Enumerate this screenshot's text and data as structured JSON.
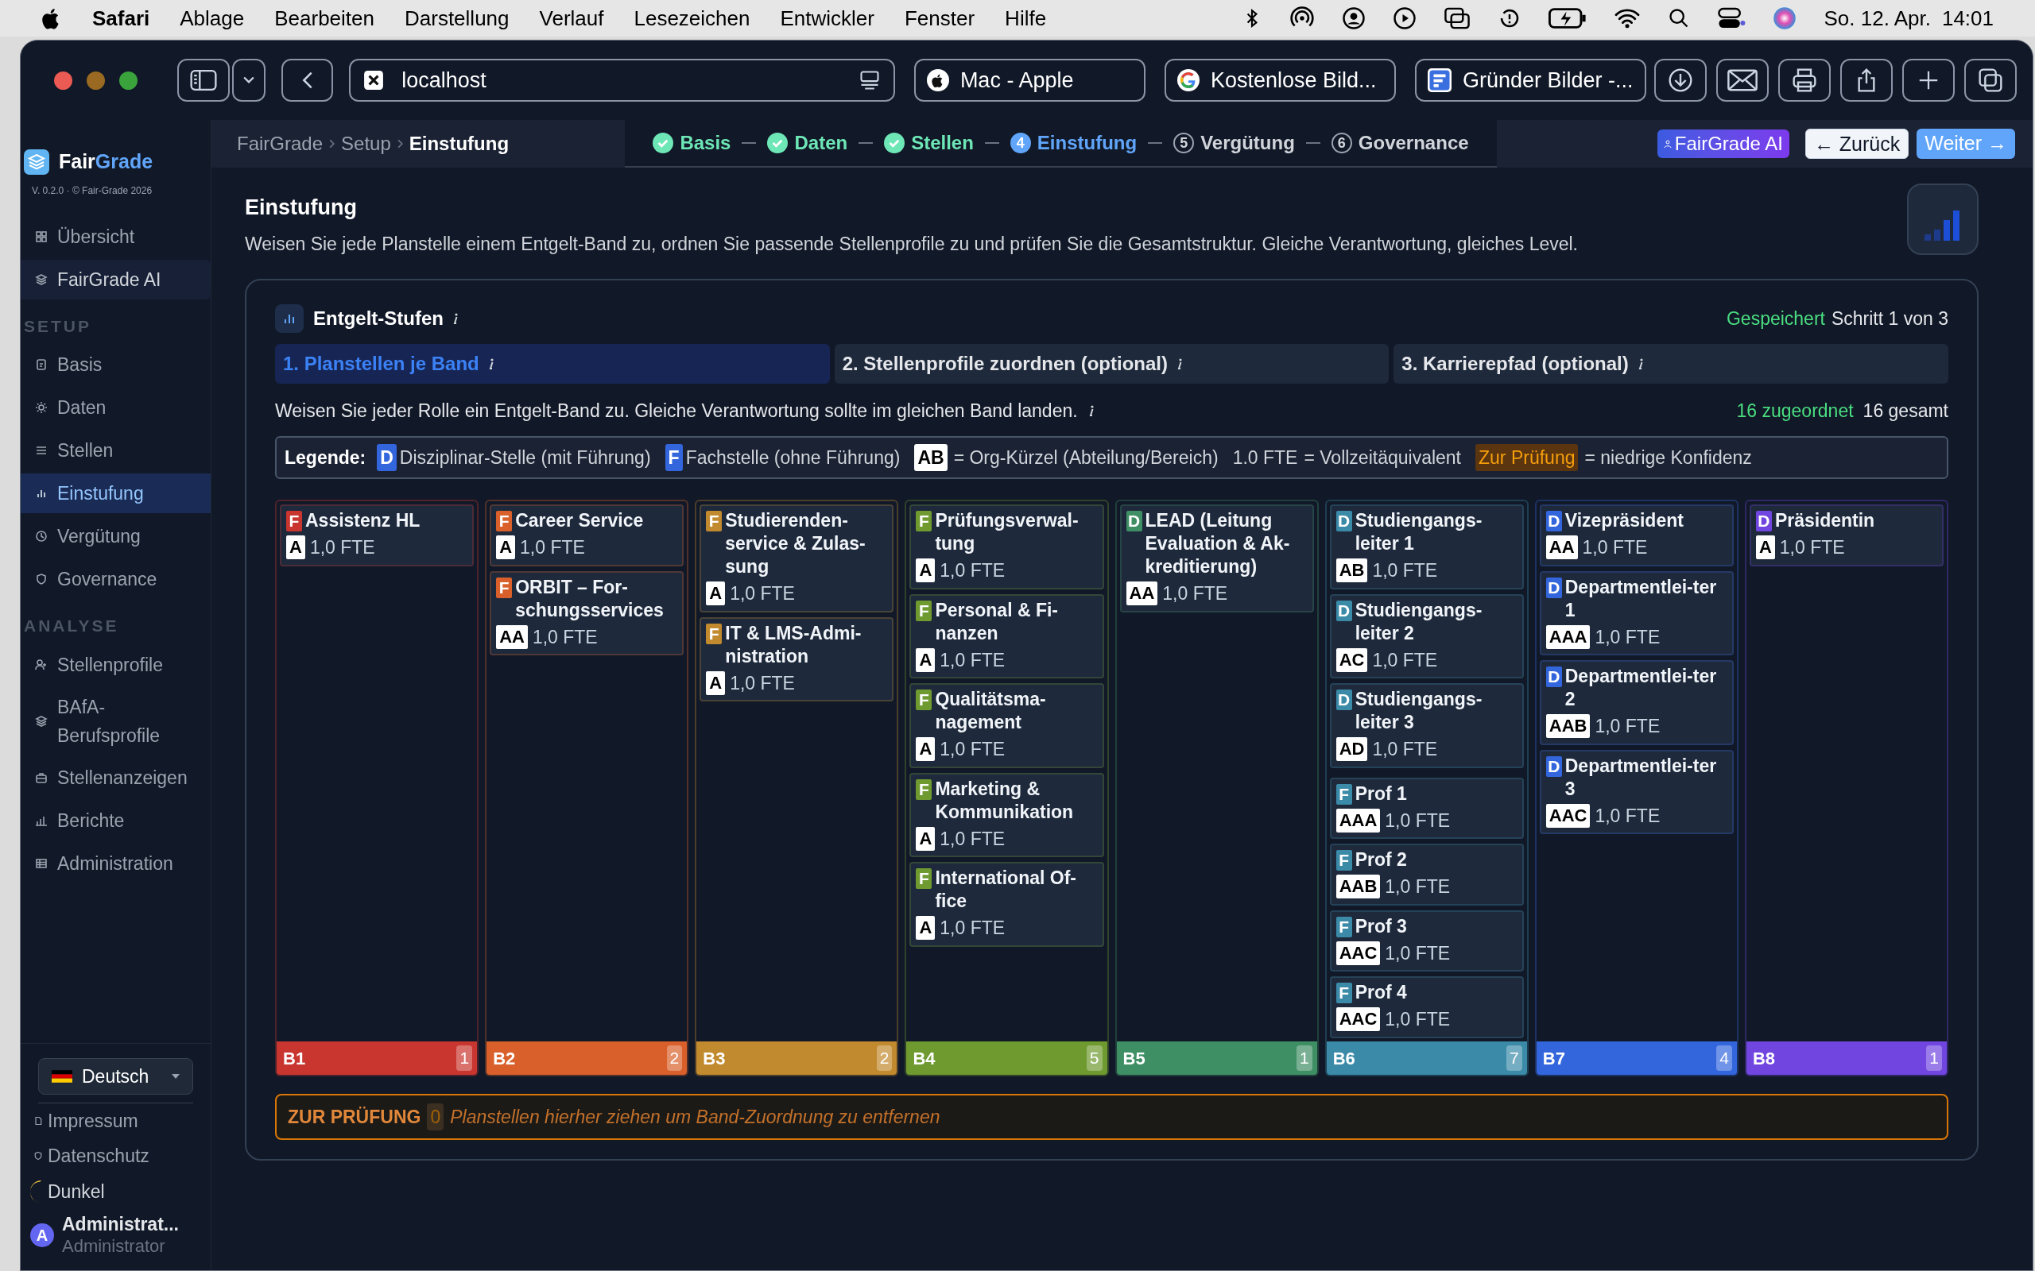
{
  "menu_bar": {
    "app": "Safari",
    "items": [
      "Ablage",
      "Bearbeiten",
      "Darstellung",
      "Verlauf",
      "Lesezeichen",
      "Entwickler",
      "Fenster",
      "Hilfe"
    ],
    "date": "So. 12. Apr.",
    "time": "14:01"
  },
  "browser": {
    "address": "localhost",
    "tabs": [
      {
        "title": "Mac - Apple"
      },
      {
        "title": "Kostenlose Bild..."
      },
      {
        "title": "Gründer Bilder -..."
      }
    ]
  },
  "sidebar": {
    "brand_first": "Fair",
    "brand_second": "Grade",
    "version": "V. 0.2.0 · © Fair-Grade 2026",
    "top_items": [
      {
        "label": "Übersicht",
        "kind": "link",
        "selected": false
      },
      {
        "label": "FairGrade AI",
        "kind": "ai",
        "selected": false
      }
    ],
    "sections": [
      {
        "title": "SETUP",
        "items": [
          {
            "label": "Basis",
            "selected": false
          },
          {
            "label": "Daten",
            "selected": false
          },
          {
            "label": "Stellen",
            "selected": false
          },
          {
            "label": "Einstufung",
            "selected": true
          },
          {
            "label": "Vergütung",
            "selected": false
          },
          {
            "label": "Governance",
            "selected": false
          }
        ]
      },
      {
        "title": "ANALYSE",
        "items": [
          {
            "label": "Stellenprofile",
            "selected": false
          },
          {
            "label": "BAfA-Berufsprofile",
            "selected": false
          },
          {
            "label": "Stellenanzeigen",
            "selected": false
          },
          {
            "label": "Berichte",
            "selected": false
          },
          {
            "label": "Administration",
            "selected": false
          }
        ]
      }
    ],
    "language": "Deutsch",
    "footer_links": [
      "Impressum",
      "Datenschutz"
    ],
    "theme": "Dunkel",
    "user": {
      "initial": "A",
      "name": "Administrat...",
      "role": "Administrator"
    }
  },
  "header": {
    "breadcrumb": [
      "FairGrade",
      "Setup",
      "Einstufung"
    ],
    "steps": [
      {
        "label": "Basis",
        "done": true,
        "selected": false
      },
      {
        "label": "Daten",
        "done": true,
        "selected": false
      },
      {
        "label": "Stellen",
        "done": true,
        "selected": false
      },
      {
        "label": "Einstufung",
        "number": "4",
        "done": false,
        "selected": true
      },
      {
        "label": "Vergütung",
        "number": "5",
        "done": false,
        "selected": false
      },
      {
        "label": "Governance",
        "number": "6",
        "done": false,
        "selected": false
      }
    ],
    "ai_button": "FairGrade AI",
    "back_button": "← Zurück",
    "next_button": "Weiter →"
  },
  "page": {
    "title": "Einstufung",
    "description": "Weisen Sie jede Planstelle einem Entgelt-Band zu, ordnen Sie passende Stellenprofile zu und prüfen Sie die Gesamtstruktur. Gleiche Verantwortung, gleiches Level."
  },
  "card": {
    "title": "Entgelt-Stufen",
    "status": "Gespeichert",
    "step": "Schritt 1 von 3",
    "tabs": [
      {
        "label": "1. Planstellen je Band",
        "selected": true
      },
      {
        "label": "2. Stellenprofile zuordnen (optional)",
        "selected": false
      },
      {
        "label": "3. Karrierepfad (optional)",
        "selected": false
      }
    ],
    "instruction": "Weisen Sie jeder Rolle ein Entgelt-Band zu. Gleiche Verantwortung sollte im gleichen Band landen.",
    "assigned": "16 zugeordnet",
    "total": "16 gesamt",
    "legend": {
      "title": "Legende:",
      "items": [
        {
          "kind": "lead",
          "badge": "D",
          "text": "Disziplinar-Stelle (mit Führung)"
        },
        {
          "kind": "expert",
          "badge": "F",
          "text": "Fachstelle (ohne Führung)"
        },
        {
          "kind": "org",
          "badge": "AB",
          "text": "= Org-Kürzel (Abteilung/Bereich)"
        },
        {
          "kind": "plain",
          "badge": "1.0 FTE",
          "text": "= Vollzeitäquivalent"
        },
        {
          "kind": "review",
          "badge": "Zur Prüfung",
          "text": "= niedrige Konfidenz"
        }
      ]
    },
    "bands": [
      {
        "name": "B1",
        "count": "1",
        "color": "#c9352f",
        "positions": [
          {
            "type": "F",
            "title": "Assistenz HL",
            "org": "A",
            "fte": "1,0 FTE"
          }
        ]
      },
      {
        "name": "B2",
        "count": "2",
        "color": "#d9602a",
        "positions": [
          {
            "type": "F",
            "title": "Career Service",
            "org": "A",
            "fte": "1,0 FTE"
          },
          {
            "type": "F",
            "title": "ORBIT – For-schungsservices",
            "org": "AA",
            "fte": "1,0 FTE"
          }
        ]
      },
      {
        "name": "B3",
        "count": "2",
        "color": "#c28a2e",
        "positions": [
          {
            "type": "F",
            "title": "Studierenden-service & Zulas-sung",
            "org": "A",
            "fte": "1,0 FTE"
          },
          {
            "type": "F",
            "title": "IT & LMS-Admi-nistration",
            "org": "A",
            "fte": "1,0 FTE"
          }
        ]
      },
      {
        "name": "B4",
        "count": "5",
        "color": "#6e9a30",
        "positions": [
          {
            "type": "F",
            "title": "Prüfungsverwal-tung",
            "org": "A",
            "fte": "1,0 FTE"
          },
          {
            "type": "F",
            "title": "Personal & Fi-nanzen",
            "org": "A",
            "fte": "1,0 FTE"
          },
          {
            "type": "F",
            "title": "Qualitätsma-nagement",
            "org": "A",
            "fte": "1,0 FTE"
          },
          {
            "type": "F",
            "title": "Marketing & Kommunikation",
            "org": "A",
            "fte": "1,0 FTE"
          },
          {
            "type": "F",
            "title": "International Of-fice",
            "org": "A",
            "fte": "1,0 FTE"
          }
        ]
      },
      {
        "name": "B5",
        "count": "1",
        "color": "#3f8f65",
        "positions": [
          {
            "type": "D",
            "title": "LEAD (Leitung Evaluation & Ak-kreditierung)",
            "org": "AA",
            "fte": "1,0 FTE"
          }
        ]
      },
      {
        "name": "B6",
        "count": "7",
        "color": "#3a8aa8",
        "positions": [
          {
            "type": "D",
            "title": "Studiengangs-leiter 1",
            "org": "AB",
            "fte": "1,0 FTE"
          },
          {
            "type": "D",
            "title": "Studiengangs-leiter 2",
            "org": "AC",
            "fte": "1,0 FTE"
          },
          {
            "type": "D",
            "title": "Studiengangs-leiter 3",
            "org": "AD",
            "fte": "1,0 FTE"
          },
          {
            "type": "F",
            "title": "Prof 1",
            "org": "AAA",
            "fte": "1,0 FTE"
          },
          {
            "type": "F",
            "title": "Prof 2",
            "org": "AAB",
            "fte": "1,0 FTE"
          },
          {
            "type": "F",
            "title": "Prof 3",
            "org": "AAC",
            "fte": "1,0 FTE"
          },
          {
            "type": "F",
            "title": "Prof 4",
            "org": "AAC",
            "fte": "1,0 FTE"
          }
        ]
      },
      {
        "name": "B7",
        "count": "4",
        "color": "#3366dd",
        "positions": [
          {
            "type": "D",
            "title": "Vizepräsident",
            "org": "AA",
            "fte": "1,0 FTE"
          },
          {
            "type": "D",
            "title": "Departmentlei-ter 1",
            "org": "AAA",
            "fte": "1,0 FTE"
          },
          {
            "type": "D",
            "title": "Departmentlei-ter 2",
            "org": "AAB",
            "fte": "1,0 FTE"
          },
          {
            "type": "D",
            "title": "Departmentlei-ter 3",
            "org": "AAC",
            "fte": "1,0 FTE"
          }
        ]
      },
      {
        "name": "B8",
        "count": "1",
        "color": "#7045e0",
        "positions": [
          {
            "type": "D",
            "title": "Präsidentin",
            "org": "A",
            "fte": "1,0 FTE"
          }
        ]
      }
    ],
    "drop_zone": {
      "label": "ZUR PRÜFUNG",
      "count": "0",
      "hint": "Planstellen hierher ziehen um Band-Zuordnung zu entfernen"
    }
  }
}
